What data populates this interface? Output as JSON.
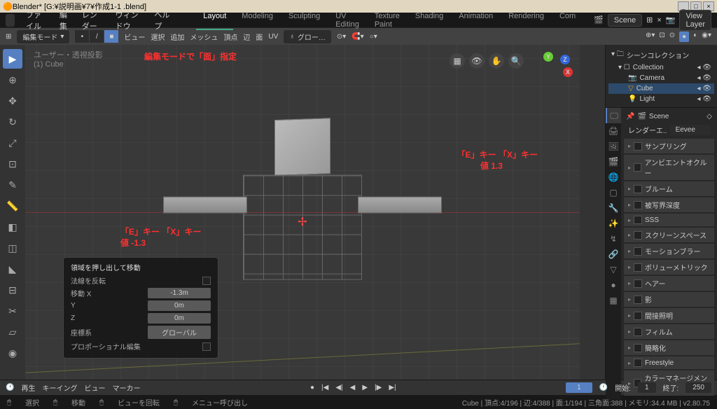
{
  "window": {
    "title": "Blender* [G:¥説明画¥7¥作成1-1 .blend]"
  },
  "menu": {
    "file": "ファイル",
    "edit": "編集",
    "render": "レンダー",
    "window": "ウィンドウ",
    "help": "ヘルプ"
  },
  "workspaces": {
    "layout": "Layout",
    "modeling": "Modeling",
    "sculpting": "Sculpting",
    "uv": "UV Editing",
    "texpaint": "Texture Paint",
    "shading": "Shading",
    "anim": "Animation",
    "rendering": "Rendering",
    "com": "Com"
  },
  "scene_strip": {
    "scene": "Scene",
    "viewlayer": "View Layer"
  },
  "toolbar": {
    "mode": "編集モード",
    "view": "ビュー",
    "select": "選択",
    "add": "追加",
    "mesh": "メッシュ",
    "vertex": "頂点",
    "edge": "辺",
    "face": "面",
    "uv": "UV",
    "global": "グロー…"
  },
  "viewport": {
    "header_line1": "ユーザー・透視投影",
    "header_line2": "(1) Cube"
  },
  "annotations": {
    "top": "編集モードで「面」指定",
    "right_l1": "「E」キー 「X」キー",
    "right_l2": "値  1.3",
    "left_l1": "「E」キー 「X」キー",
    "left_l2": "値  -1.3"
  },
  "operator_panel": {
    "title": "領域を押し出して移動",
    "flip_normals": "法線を反転",
    "move_x_label": "移動 X",
    "move_x": "-1.3m",
    "y_label": "Y",
    "y": "0m",
    "z_label": "Z",
    "z": "0m",
    "orient_label": "座標系",
    "orient": "グローバル",
    "prop_edit": "プロポーショナル編集"
  },
  "outliner": {
    "title": "シーンコレクション",
    "collection": "Collection",
    "camera": "Camera",
    "cube": "Cube",
    "light": "Light"
  },
  "properties": {
    "scene": "Scene",
    "render_engine_label": "レンダーエ..",
    "render_engine": "Eevee",
    "panels": [
      "サンプリング",
      "アンビエントオクルー",
      "ブルーム",
      "被写界深度",
      "SSS",
      "スクリーンスペース",
      "モーションブラー",
      "ボリューメトリック",
      "ヘアー",
      "影",
      "間接照明",
      "フィルム",
      "簡略化",
      "Freestyle",
      "カラーマネージメント"
    ]
  },
  "timeline": {
    "playback": "再生",
    "keying": "キーイング",
    "view": "ビュー",
    "marker": "マーカー",
    "current": "1",
    "start_label": "開始:",
    "start": "1",
    "end_label": "終了:",
    "end": "250"
  },
  "statusbar": {
    "lmb": "選択",
    "mmb": "移動",
    "mmb2": "ビューを回転",
    "rmb": "メニュー呼び出し",
    "stats": "Cube | 頂点:4/196 | 辺:4/388 | 面:1/194 | 三角面:388 | メモリ:34.4 MB | v2.80.75"
  }
}
